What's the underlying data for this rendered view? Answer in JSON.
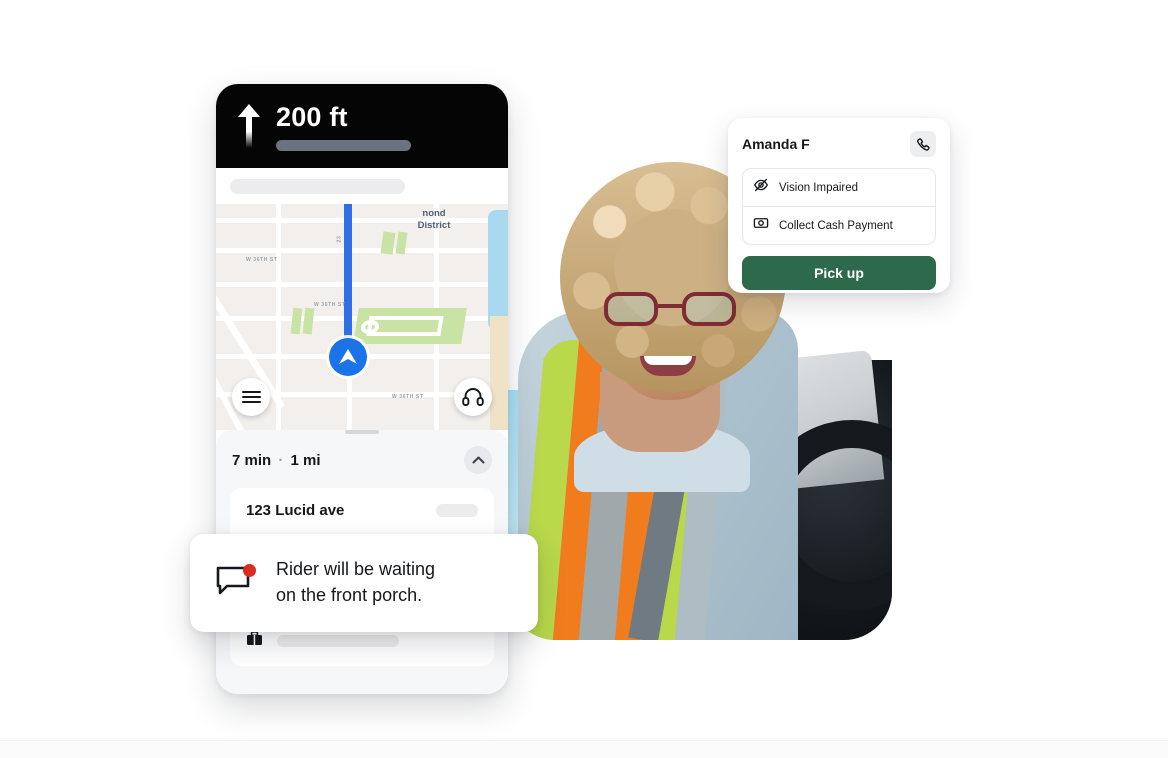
{
  "navigation": {
    "distance": "200 ft",
    "arrow_icon": "up-arrow-icon"
  },
  "map": {
    "district_label": "nond\nDistrict",
    "district_label_line1": "nond",
    "district_label_line2": "District",
    "streets": [
      "W 36TH ST",
      "W 36TH ST",
      "W 36TH ST",
      "23"
    ],
    "puck_icon": "navigation-puck-icon",
    "menu_icon": "hamburger-menu-icon",
    "support_icon": "headset-support-icon",
    "route_color": "#2f6fe4",
    "park_color": "#c8e3a4",
    "background_color": "#f3efec"
  },
  "trip_sheet": {
    "eta_minutes": "7 min",
    "separator": "·",
    "distance": "1 mi",
    "collapse_icon": "chevron-up-icon",
    "address": "123 Lucid ave",
    "bag_icon": "briefcase-icon"
  },
  "rider_card": {
    "name": "Amanda F",
    "call_icon": "phone-icon",
    "attributes": [
      {
        "icon": "eye-off-icon",
        "label": "Vision Impaired"
      },
      {
        "icon": "cash-payment-icon",
        "label": "Collect Cash Payment"
      }
    ],
    "pickup_label": "Pick up",
    "pickup_color": "#2d6a4c"
  },
  "message_toast": {
    "icon": "message-bubble-icon",
    "badge_color": "#d92d20",
    "line1": "Rider will be waiting",
    "line2": "on the front porch."
  }
}
